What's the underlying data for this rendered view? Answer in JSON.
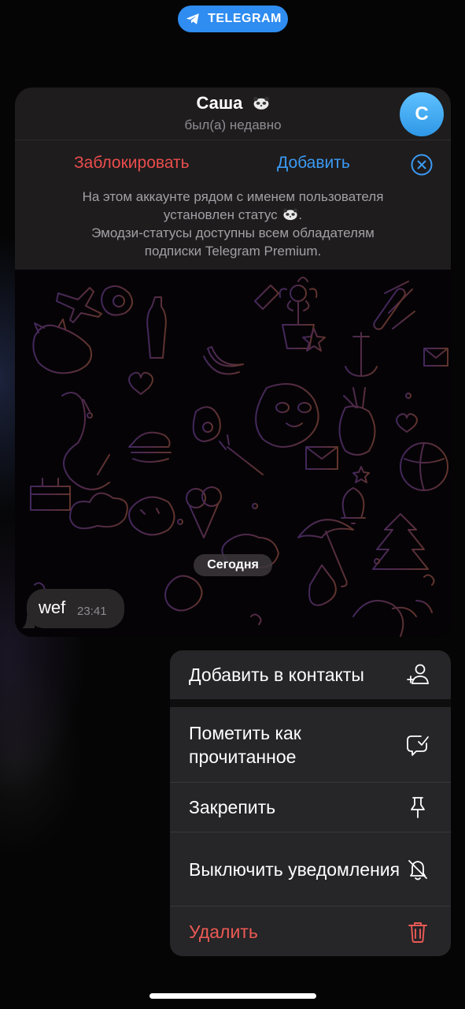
{
  "banner": {
    "label": "TELEGRAM",
    "color": "#2f8cf0"
  },
  "chat_header": {
    "name": "Саша",
    "status": "был(а) недавно",
    "avatar_letter": "С",
    "status_emoji": "panda-emoji"
  },
  "actions": {
    "block_label": "Заблокировать",
    "add_label": "Добавить",
    "block_color": "#eb4d4d",
    "add_color": "#3b9af3"
  },
  "notice": {
    "line1": "На этом аккаунте рядом с именем пользователя",
    "line2": "установлен статус",
    "line3": "Эмодзи-статусы доступны всем обладателям",
    "line4": "подписки Telegram Premium."
  },
  "chat": {
    "date_label": "Сегодня",
    "messages": [
      {
        "text": "wef",
        "time": "23:41"
      }
    ]
  },
  "context_menu": {
    "items": [
      {
        "label": "Добавить в контакты",
        "icon": "add-contact-icon"
      },
      {
        "label": "Пометить как прочитанное",
        "icon": "mark-read-icon"
      },
      {
        "label": "Закрепить",
        "icon": "pin-icon"
      },
      {
        "label": "Выключить уведомления",
        "icon": "mute-bell-icon"
      },
      {
        "label": "Удалить",
        "icon": "trash-icon",
        "color": "#ec5a55"
      }
    ]
  }
}
